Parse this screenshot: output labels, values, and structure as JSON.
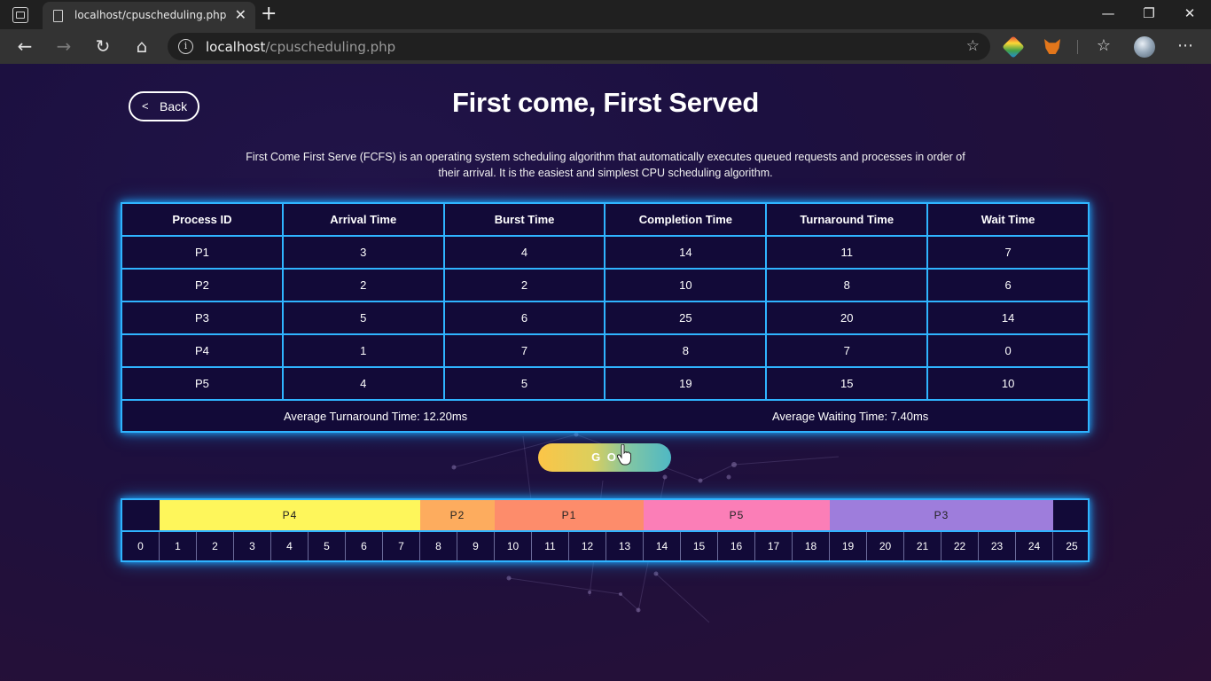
{
  "browser": {
    "tab_title": "localhost/cpuscheduling.php",
    "close_glyph": "✕",
    "new_tab_glyph": "+",
    "address_host": "localhost",
    "address_path": "/cpuscheduling.php",
    "minimize_glyph": "—",
    "restore_glyph": "❐",
    "close_window_glyph": "✕"
  },
  "page": {
    "back_label": "Back",
    "title": "First come, First Served",
    "description": "First Come First Serve (FCFS) is an operating system scheduling algorithm that automatically executes queued requests and processes in order of their arrival. It is the easiest and simplest CPU scheduling algorithm.",
    "go_label": "G O"
  },
  "table": {
    "headers": [
      "Process ID",
      "Arrival Time",
      "Burst Time",
      "Completion Time",
      "Turnaround Time",
      "Wait Time"
    ],
    "rows": [
      [
        "P1",
        "3",
        "4",
        "14",
        "11",
        "7"
      ],
      [
        "P2",
        "2",
        "2",
        "10",
        "8",
        "6"
      ],
      [
        "P3",
        "5",
        "6",
        "25",
        "20",
        "14"
      ],
      [
        "P4",
        "1",
        "7",
        "8",
        "7",
        "0"
      ],
      [
        "P5",
        "4",
        "5",
        "19",
        "15",
        "10"
      ]
    ],
    "avg_turnaround": "Average Turnaround Time: 12.20ms",
    "avg_waiting": "Average Waiting Time: 7.40ms"
  },
  "gantt": {
    "start": 0,
    "end": 25,
    "segments": [
      {
        "label": "P4",
        "start": 1,
        "end": 8,
        "color": "#fef65b"
      },
      {
        "label": "P2",
        "start": 8,
        "end": 10,
        "color": "#fdac5e"
      },
      {
        "label": "P1",
        "start": 10,
        "end": 14,
        "color": "#fd8c6b"
      },
      {
        "label": "P5",
        "start": 14,
        "end": 19,
        "color": "#fb7eb7"
      },
      {
        "label": "P3",
        "start": 19,
        "end": 25,
        "color": "#9e7ddc"
      }
    ],
    "ticks": [
      "0",
      "1",
      "2",
      "3",
      "4",
      "5",
      "6",
      "7",
      "8",
      "9",
      "10",
      "11",
      "12",
      "13",
      "14",
      "15",
      "16",
      "17",
      "18",
      "19",
      "20",
      "21",
      "22",
      "23",
      "24",
      "25"
    ]
  },
  "colors": {
    "page_bg": "#1c1040",
    "neon_border": "#2fb4ff",
    "cell_bg": "#120a38"
  }
}
